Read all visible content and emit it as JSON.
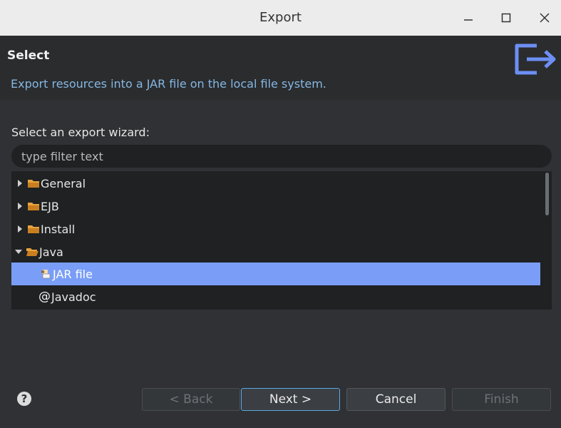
{
  "window": {
    "title": "Export",
    "minimize_icon": "minimize-icon",
    "maximize_icon": "maximize-icon",
    "close_icon": "close-icon"
  },
  "header": {
    "title": "Select",
    "description": "Export resources into a JAR file on the local file system.",
    "icon": "export-icon",
    "icon_color": "#6d8ff5"
  },
  "wizard": {
    "label": "Select an export wizard:",
    "filter_placeholder": "type filter text",
    "filter_value": ""
  },
  "tree": {
    "items": [
      {
        "label": "General",
        "type": "folder",
        "expanded": false,
        "selected": false
      },
      {
        "label": "EJB",
        "type": "folder",
        "expanded": false,
        "selected": false
      },
      {
        "label": "Install",
        "type": "folder",
        "expanded": false,
        "selected": false
      },
      {
        "label": "Java",
        "type": "folder",
        "expanded": true,
        "selected": false
      },
      {
        "label": "JAR file",
        "type": "jar-file-icon",
        "selected": true
      },
      {
        "label": "Javadoc",
        "type": "javadoc-icon",
        "icon_glyph": "@",
        "selected": false
      }
    ],
    "folder_color": "#e8a33d",
    "selection_color": "#7a9ef7"
  },
  "buttons": {
    "back": "< Back",
    "next": "Next >",
    "cancel": "Cancel",
    "finish": "Finish",
    "help": "?"
  }
}
